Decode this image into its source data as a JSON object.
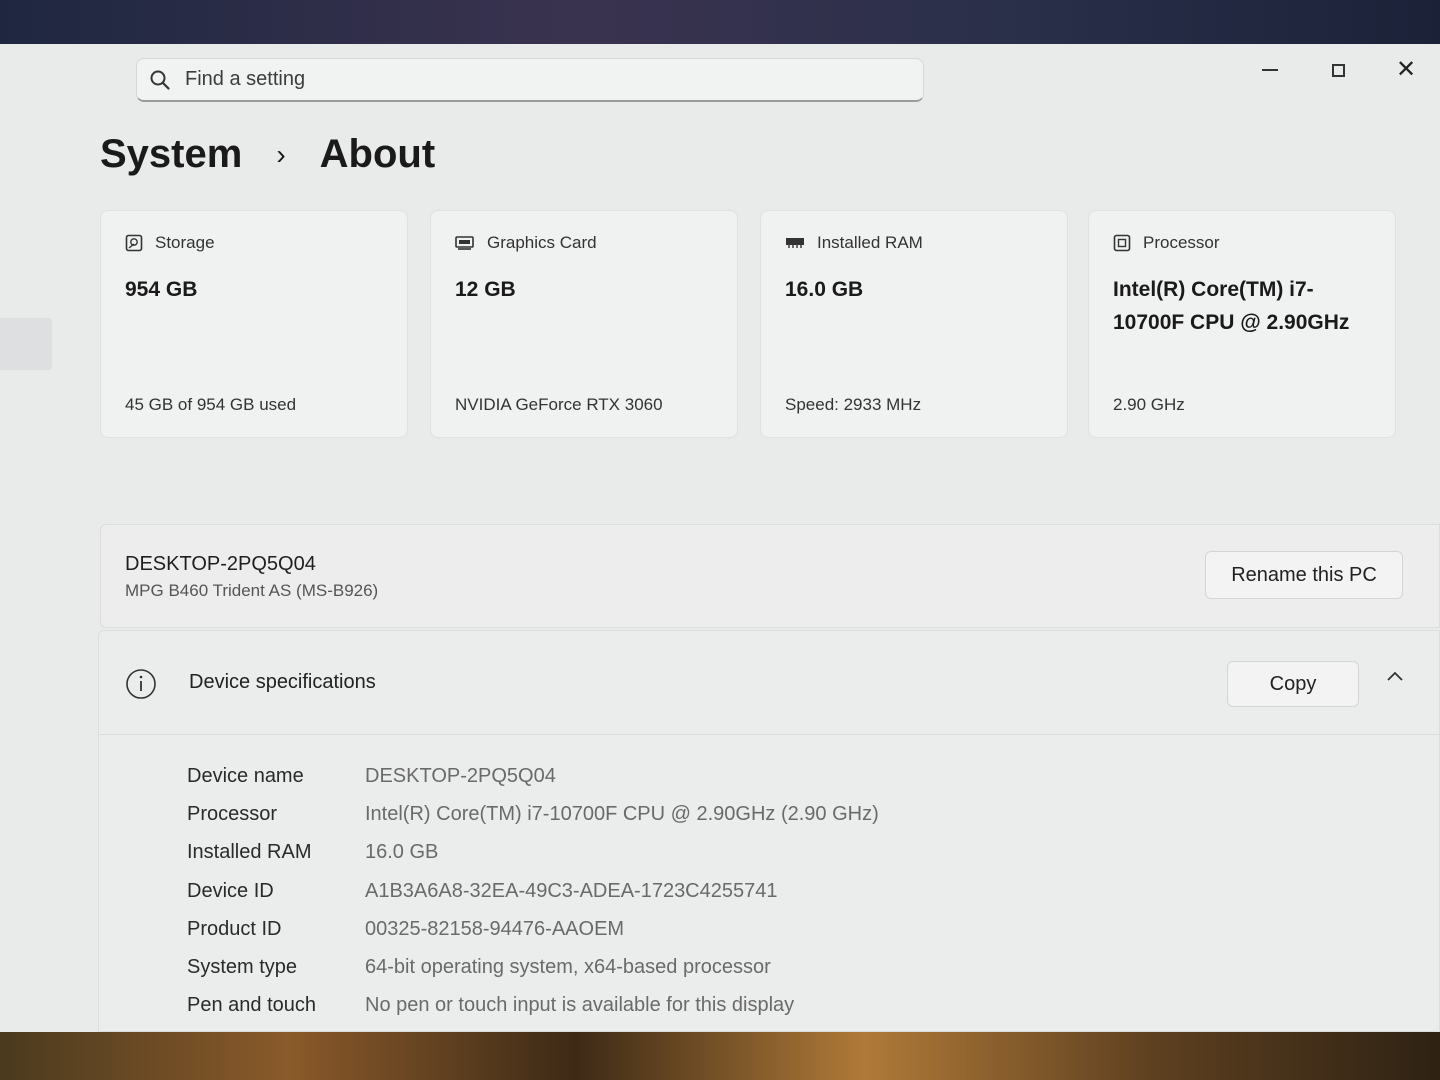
{
  "search": {
    "placeholder": "Find a setting"
  },
  "breadcrumb": {
    "parent": "System",
    "separator": "›",
    "current": "About"
  },
  "cards": [
    {
      "icon": "storage-icon",
      "label": "Storage",
      "value": "954 GB",
      "sub": "45 GB of 954 GB used"
    },
    {
      "icon": "graphics-card-icon",
      "label": "Graphics Card",
      "value": "12 GB",
      "sub": "NVIDIA GeForce RTX 3060"
    },
    {
      "icon": "ram-icon",
      "label": "Installed RAM",
      "value": "16.0 GB",
      "sub": "Speed: 2933 MHz"
    },
    {
      "icon": "processor-icon",
      "label": "Processor",
      "value": "Intel(R) Core(TM) i7-10700F CPU @ 2.90GHz",
      "sub": "2.90 GHz"
    }
  ],
  "pc": {
    "name": "DESKTOP-2PQ5Q04",
    "model": "MPG B460 Trident AS (MS-B926)",
    "rename_label": "Rename this PC"
  },
  "specs": {
    "title": "Device specifications",
    "copy_label": "Copy",
    "rows": [
      {
        "key": "Device name",
        "value": "DESKTOP-2PQ5Q04"
      },
      {
        "key": "Processor",
        "value": "Intel(R) Core(TM) i7-10700F CPU @ 2.90GHz (2.90 GHz)"
      },
      {
        "key": "Installed RAM",
        "value": "16.0 GB"
      },
      {
        "key": "Device ID",
        "value": "A1B3A6A8-32EA-49C3-ADEA-1723C4255741"
      },
      {
        "key": "Product ID",
        "value": "00325-82158-94476-AAOEM"
      },
      {
        "key": "System type",
        "value": "64-bit operating system, x64-based processor"
      },
      {
        "key": "Pen and touch",
        "value": "No pen or touch input is available for this display"
      }
    ]
  }
}
